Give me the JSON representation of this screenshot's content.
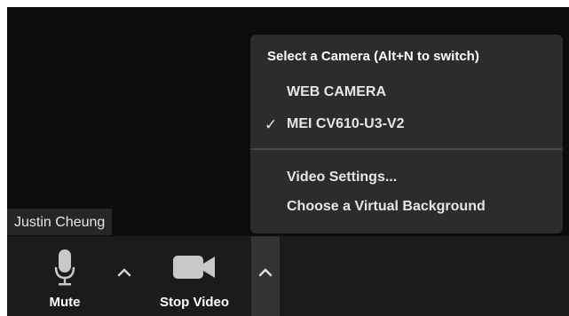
{
  "participant": {
    "name": "Justin Cheung"
  },
  "toolbar": {
    "mute_label": "Mute",
    "stop_video_label": "Stop Video",
    "mute_icon": "microphone-icon",
    "video_icon": "video-camera-icon",
    "caret_icon": "chevron-up-icon"
  },
  "camera_menu": {
    "heading": "Select a Camera (Alt+N to switch)",
    "cameras": [
      {
        "label": "WEB CAMERA",
        "selected": false
      },
      {
        "label": "MEI CV610-U3-V2",
        "selected": true
      }
    ],
    "check_glyph": "✓",
    "actions": [
      {
        "label": "Video Settings..."
      },
      {
        "label": "Choose a Virtual Background"
      }
    ]
  },
  "colors": {
    "background": "#0c0c0c",
    "menu_background": "#2c2c2c",
    "toolbar_background": "#1b1b1b",
    "text": "#ffffff"
  }
}
